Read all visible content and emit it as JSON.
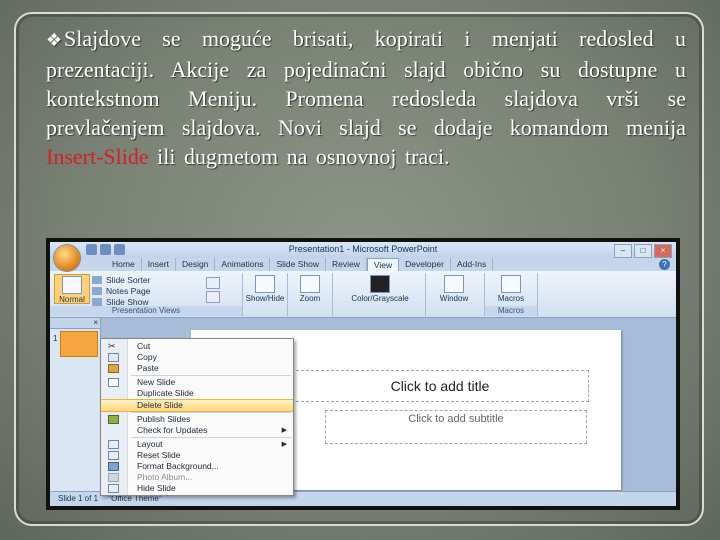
{
  "body_text": {
    "lead": "Slajdove se moguće brisati, kopirati i menjati redosled u prezentaciji. Akcije za pojedinačni slajd obično su dostupne u kontekstnom Meniju. Promena redosleda slajdova vrši se prevlačenjem slajdova. Novi slajd se dodaje komandom menija ",
    "highlight": "Insert-Slide",
    "tail": " ili dugmetom na osnovnoj traci."
  },
  "colors": {
    "highlight": "#d0202a",
    "text": "#ffffff"
  },
  "ppt": {
    "window_title": "Presentation1 - Microsoft PowerPoint",
    "tabs": [
      "Home",
      "Insert",
      "Design",
      "Animations",
      "Slide Show",
      "Review",
      "View",
      "Developer",
      "Add-Ins"
    ],
    "active_tab": "View",
    "ribbon": {
      "normal": "Normal",
      "slide_sorter": "Slide Sorter",
      "notes_page": "Notes Page",
      "slide_show": "Slide Show",
      "presentation_views_label": "Presentation Views",
      "show_hide": "Show/Hide",
      "zoom": "Zoom",
      "color_grayscale": "Color/Grayscale",
      "window": "Window",
      "macros": "Macros",
      "macros_label": "Macros"
    },
    "slide_number": "1",
    "placeholders": {
      "title": "Click to add title",
      "subtitle": "Click to add subtitle"
    },
    "status": {
      "slide_of": "Slide 1 of 1",
      "theme": "\"Office Theme\""
    },
    "context_menu": [
      {
        "label": "Cut",
        "icon": "scissors-icon"
      },
      {
        "label": "Copy",
        "icon": "copy-icon"
      },
      {
        "label": "Paste",
        "icon": "paste-icon"
      },
      {
        "label": "New Slide",
        "icon": "new-slide-icon"
      },
      {
        "label": "Duplicate Slide",
        "icon": ""
      },
      {
        "label": "Delete Slide",
        "icon": "",
        "highlighted": true
      },
      {
        "label": "Publish Slides",
        "icon": "publish-icon"
      },
      {
        "label": "Check for Updates",
        "icon": "",
        "submenu": true
      },
      {
        "label": "Layout",
        "icon": "layout-icon",
        "submenu": true
      },
      {
        "label": "Reset Slide",
        "icon": "reset-icon"
      },
      {
        "label": "Format Background...",
        "icon": "format-background-icon"
      },
      {
        "label": "Photo Album...",
        "icon": "photo-album-icon",
        "disabled": true
      },
      {
        "label": "Hide Slide",
        "icon": "hide-slide-icon"
      }
    ]
  }
}
